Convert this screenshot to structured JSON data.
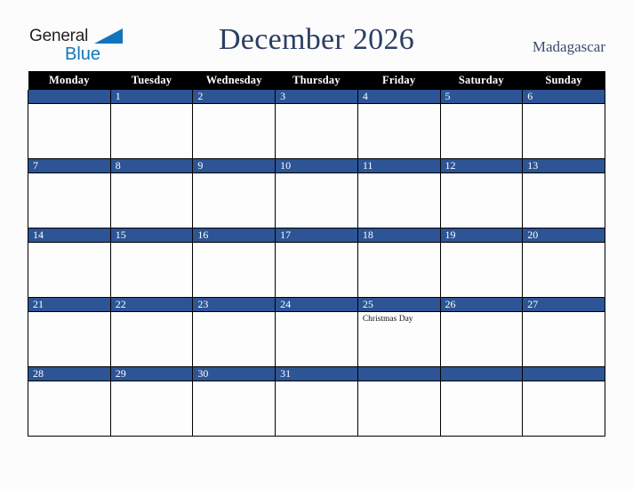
{
  "header": {
    "logo": {
      "word1": "General",
      "word2": "Blue",
      "triangle_color": "#1275bc",
      "word1_color": "#231f20"
    },
    "title": "December 2026",
    "title_color": "#2c3e63",
    "country": "Madagascar"
  },
  "calendar": {
    "accent_color": "#2d5494",
    "header_bg": "#000000",
    "weekday_headers": [
      "Monday",
      "Tuesday",
      "Wednesday",
      "Thursday",
      "Friday",
      "Saturday",
      "Sunday"
    ],
    "weeks": [
      [
        {
          "day": "",
          "events": []
        },
        {
          "day": "1",
          "events": []
        },
        {
          "day": "2",
          "events": []
        },
        {
          "day": "3",
          "events": []
        },
        {
          "day": "4",
          "events": []
        },
        {
          "day": "5",
          "events": []
        },
        {
          "day": "6",
          "events": []
        }
      ],
      [
        {
          "day": "7",
          "events": []
        },
        {
          "day": "8",
          "events": []
        },
        {
          "day": "9",
          "events": []
        },
        {
          "day": "10",
          "events": []
        },
        {
          "day": "11",
          "events": []
        },
        {
          "day": "12",
          "events": []
        },
        {
          "day": "13",
          "events": []
        }
      ],
      [
        {
          "day": "14",
          "events": []
        },
        {
          "day": "15",
          "events": []
        },
        {
          "day": "16",
          "events": []
        },
        {
          "day": "17",
          "events": []
        },
        {
          "day": "18",
          "events": []
        },
        {
          "day": "19",
          "events": []
        },
        {
          "day": "20",
          "events": []
        }
      ],
      [
        {
          "day": "21",
          "events": []
        },
        {
          "day": "22",
          "events": []
        },
        {
          "day": "23",
          "events": []
        },
        {
          "day": "24",
          "events": []
        },
        {
          "day": "25",
          "events": [
            "Christmas Day"
          ]
        },
        {
          "day": "26",
          "events": []
        },
        {
          "day": "27",
          "events": []
        }
      ],
      [
        {
          "day": "28",
          "events": []
        },
        {
          "day": "29",
          "events": []
        },
        {
          "day": "30",
          "events": []
        },
        {
          "day": "31",
          "events": []
        },
        {
          "day": "",
          "events": []
        },
        {
          "day": "",
          "events": []
        },
        {
          "day": "",
          "events": []
        }
      ]
    ]
  }
}
